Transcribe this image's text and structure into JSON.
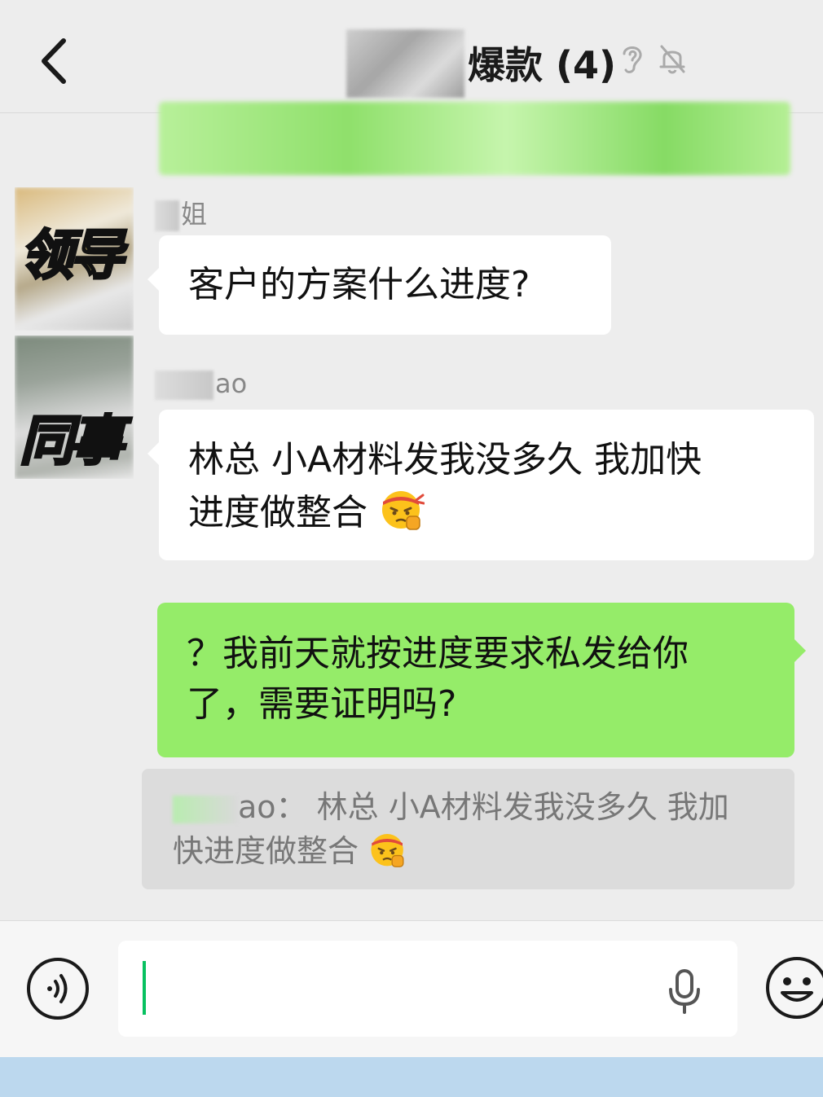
{
  "header": {
    "title": "爆款 (4)",
    "back_icon": "chevron-left-icon",
    "status_icons": [
      "ear-icon",
      "bell-muted-icon"
    ]
  },
  "messages": [
    {
      "avatar_label": "领导",
      "sender": "姐",
      "text": "客户的方案什么进度?"
    },
    {
      "avatar_label": "同事",
      "sender": "ao",
      "text_line1": "林总 小A材料发我没多久 我加快",
      "text_line2": "进度做整合",
      "emoji": "saluting-fist-face-emoji"
    },
    {
      "mine": true,
      "text_line1": "？我前天就按进度要求私发给你",
      "text_line2": "了，需要证明吗?"
    }
  ],
  "quote": {
    "sender": "ao：",
    "text_line1": "林总 小A材料发我没多久 我加",
    "text_line2": "快进度做整合"
  },
  "input": {
    "value": "",
    "voice_icon": "voice-input-icon",
    "mic_icon": "microphone-icon",
    "emoji_icon": "smiley-icon"
  },
  "colors": {
    "background": "#ededed",
    "my_bubble": "#95ec69",
    "other_bubble": "#ffffff",
    "caret": "#07c160"
  }
}
